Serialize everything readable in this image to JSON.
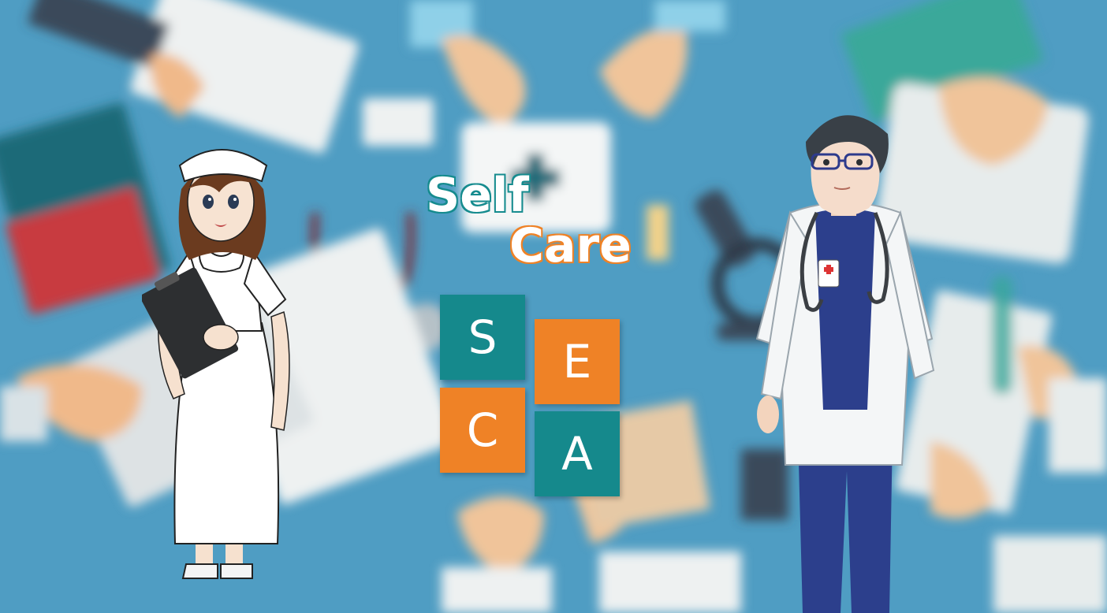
{
  "title": {
    "line1": "Self",
    "line2": "Care",
    "line1_color": "#158b8e",
    "line2_color": "#ef8226"
  },
  "logo_tiles": [
    {
      "letter": "S",
      "color": "#15898c"
    },
    {
      "letter": "E",
      "color": "#ef8226"
    },
    {
      "letter": "C",
      "color": "#ef8226"
    },
    {
      "letter": "A",
      "color": "#15898c"
    }
  ],
  "colors": {
    "background": "#4f9dc3",
    "teal": "#15898c",
    "orange": "#ef8226",
    "scrubs": "#2c3f8c"
  },
  "characters": [
    "nurse-illustration",
    "doctor-illustration"
  ]
}
